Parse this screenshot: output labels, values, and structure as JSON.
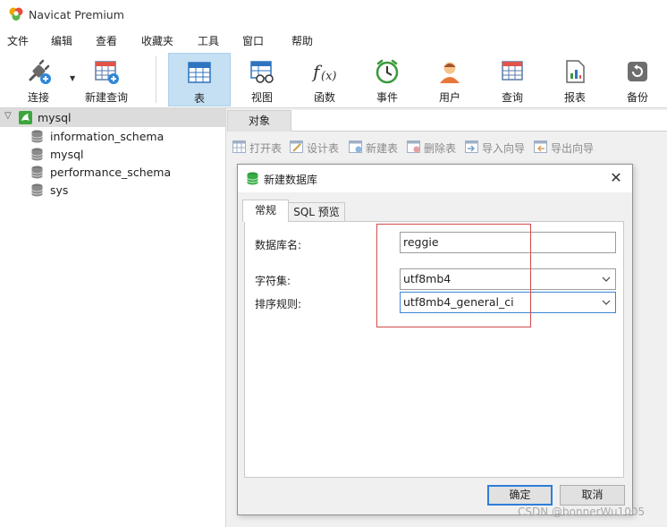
{
  "window": {
    "title": "Navicat Premium"
  },
  "menu": [
    "文件",
    "编辑",
    "查看",
    "收藏夹",
    "工具",
    "窗口",
    "帮助"
  ],
  "toolbar": {
    "connect": "连接",
    "new_query": "新建查询",
    "table": "表",
    "view": "视图",
    "function": "函数",
    "event": "事件",
    "user": "用户",
    "query": "查询",
    "report": "报表",
    "backup": "备份"
  },
  "tree": {
    "connection": "mysql",
    "databases": [
      "information_schema",
      "mysql",
      "performance_schema",
      "sys"
    ]
  },
  "object_tab": {
    "label": "对象"
  },
  "object_toolbar": {
    "open_table": "打开表",
    "design_table": "设计表",
    "new_table": "新建表",
    "delete_table": "删除表",
    "import_wizard": "导入向导",
    "export_wizard": "导出向导"
  },
  "dialog": {
    "title": "新建数据库",
    "tabs": [
      "常规",
      "SQL 预览"
    ],
    "db_name_label": "数据库名:",
    "db_name_value": "reggie",
    "charset_label": "字符集:",
    "charset_value": "utf8mb4",
    "collation_label": "排序规则:",
    "collation_value": "utf8mb4_general_ci",
    "ok": "确定",
    "cancel": "取消"
  },
  "watermark": "CSDN @bonnerWu1005",
  "colors": {
    "highlight": "#d54b4b",
    "accent": "#2f7ed8",
    "active_tool": "#c5dff3"
  }
}
